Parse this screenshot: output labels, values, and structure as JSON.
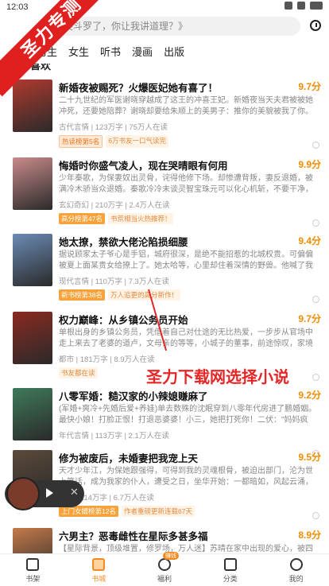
{
  "status_bar": {
    "time": "12:03"
  },
  "watermark": "圣力专测",
  "search": {
    "placeholder": "笑斗罗了，你让我讲道理？》"
  },
  "tabs": [
    "男生",
    "女生",
    "听书",
    "漫画",
    "出版"
  ],
  "section_title": "猜你喜欢",
  "annotation": "圣力下载网选择小说",
  "colors": {
    "accent": "#f38a1e",
    "score": "#f08c00",
    "watermark": "#e0201f",
    "annotation": "#e62626"
  },
  "books": [
    {
      "title": "新婚夜被赐死？火爆医妃她有喜了！",
      "score": "9.7分",
      "desc": "二十九世纪的军医谢晓穿越成了这王的冲喜王妃。新婚夜当天夫君被被她冲死，还要她陪葬？谢晓却要给朱顺上的美男子：推你的美貌被我了你。我讨一扎，凌王殿...",
      "meta": "古代言情 | 123万字 | 75万人在读",
      "tags": [
        {
          "text": "热读榜第5名",
          "style": "hot"
        },
        {
          "text": "6万书友一口气读完",
          "style": "plain"
        }
      ],
      "cover": "#b03a2e"
    },
    {
      "title": "悔婚时你盛气凌人，现在哭晴眼有何用",
      "score": "9.9分",
      "desc": "少年秦歌，为保妻奴出灵骨，诧得他修下场。却惨遭背叛，妻反退婚，被满冷木骄当众退婚。秦歌冷冷未谈灵智宝珠元可以化心机斩，不要干净，我成鑫舞，是比三...",
      "meta": "玄幻奇幻 | 210万字 | 2.4万人在读",
      "tags": [
        {
          "text": "高分榜第47名",
          "style": "rank"
        },
        {
          "text": "书荒相当火热推荐！",
          "style": "plain"
        }
      ],
      "cover": "#c98a8a"
    },
    {
      "title": "她太撩，禁欲大佬沦陷损细腰",
      "score": "9.4分",
      "desc": "据说顾家太子爷心是手铝，城府很深，是绝不能招惹的北城权贵。可偏偏被夏上面某贵女给撩上了。她太哈等，心里却住着深情的野兽。他喊了我想不干不不净，她为难我了...",
      "meta": "现代言情 | 110万字 | 7.3万人在读",
      "tags": [
        {
          "text": "新书榜第38名",
          "style": "rank"
        },
        {
          "text": "万人追更的高分新作！",
          "style": "plain"
        }
      ],
      "cover": "#6b8bb5"
    },
    {
      "title": "权力巅峰：从乡镇公务员开始",
      "score": "9.7分",
      "desc": "单根出身的乡镇公务员，凭借着自己对仕途的无比热爱，一步步从官场中走上来去了老婆的道卢，文母亲的等等，小城子的董事，前途惊叹，家境前流。快速上了一路...",
      "meta": "都市 | 181万字 | 8.9万人在读",
      "tags": [
        {
          "text": "书友都在读",
          "style": "plain"
        }
      ],
      "cover": "#8a2a20"
    },
    {
      "title": "八零军婚：糙汉家的小辣媳赚麻了",
      "score": "9.2分",
      "desc": "(军婚+爽冷+先婚后爱+养娃)单去数殊的沈眠穿到八零年代房进了鹏婚姻。最快小娘！打脸正恨！打退恶婆婆！小三，她把打死你！二伏：\"妈妈疯了！\"大娃：\"我爽乐...",
      "meta": "年代言情 | 113万字 | 2.1万人在读",
      "tags": [],
      "cover": "#3f7a5a"
    },
    {
      "title": "修为被废后，未婚妻把我宠上天",
      "score": "9.5分",
      "desc": "天才少年江，为保她跟强得，可得到我的灵魂根骨，被迫出部门，沦为世上笑话，成为我家的仆人，遭受之日，坐华开始：一都暗如，风起云涌，全都在走池中，一遇双去所...",
      "meta": "玄幻 | 114万字 | 6.7万人在读",
      "tags": [
        {
          "text": "上门女婿榜第12名",
          "style": "rank"
        },
        {
          "text": "作者重磅更新连载67天",
          "style": "plain"
        }
      ],
      "cover": "#5a4a3a"
    },
    {
      "title": "六男主？恶毒雌性在星际多甚多福",
      "score": "8.9分",
      "desc": "【星际背景，顶级堆置，修罗场，万人迷】苏晴在家中出现的爱心，被四周的星际兽...",
      "meta": "",
      "tags": [],
      "cover": "#c47a4a"
    }
  ],
  "player": {
    "close": "✕"
  },
  "bottom_nav": [
    {
      "label": "书架",
      "icon": "bookshelf-icon",
      "active": false
    },
    {
      "label": "书城",
      "icon": "home-icon",
      "active": true
    },
    {
      "label": "福利",
      "icon": "gift-icon",
      "active": false,
      "badge": "赚钱"
    },
    {
      "label": "分类",
      "icon": "grid-icon",
      "active": false
    },
    {
      "label": "我的",
      "icon": "user-icon",
      "active": false
    }
  ]
}
